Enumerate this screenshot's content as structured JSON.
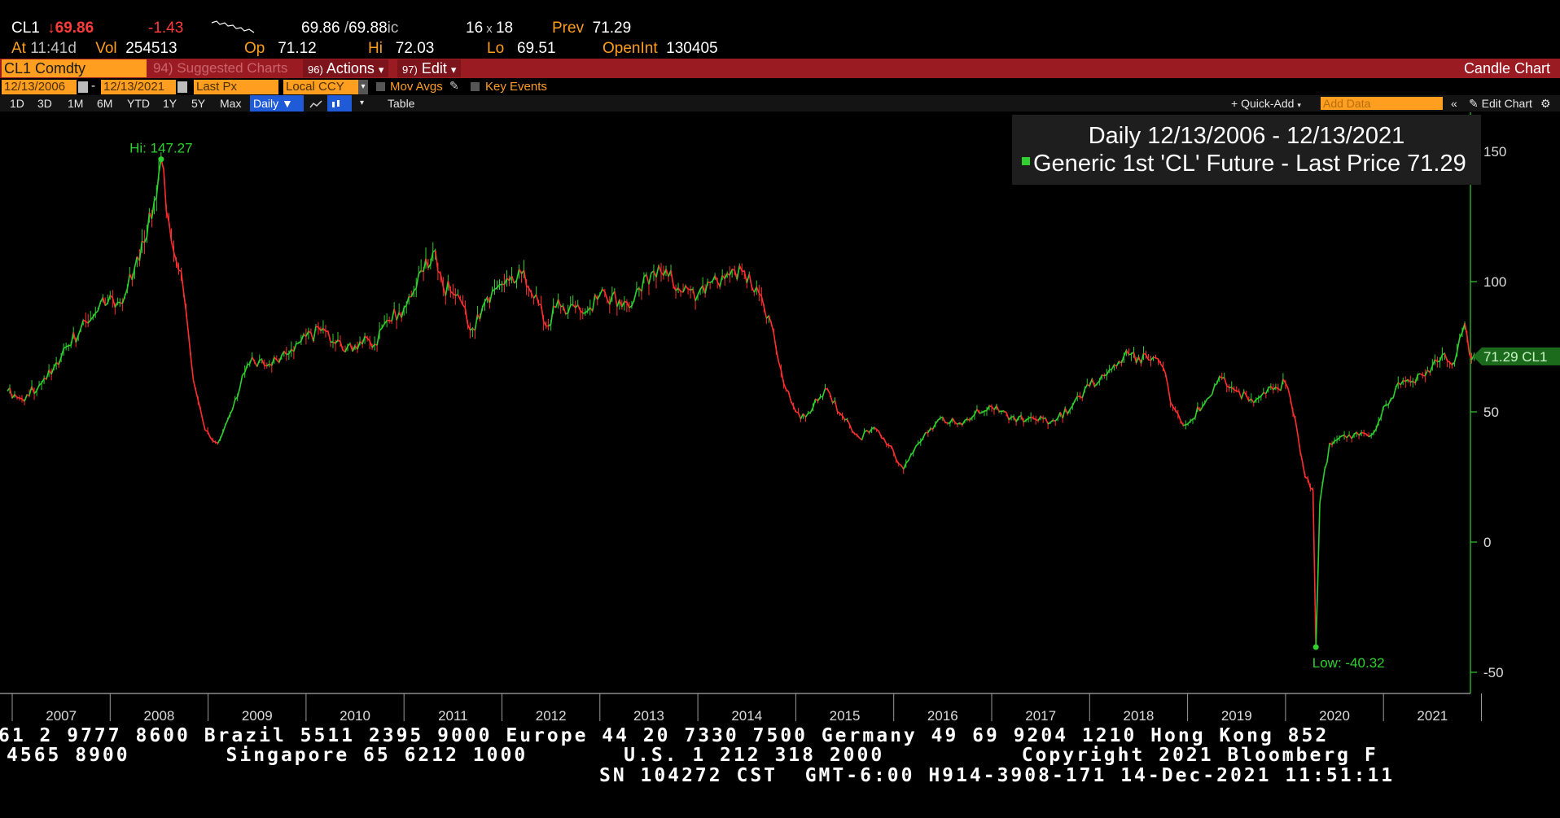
{
  "quote": {
    "ticker": "CL1",
    "last": "69.86",
    "change": "-1.43",
    "bid_ask_a": "69.86",
    "bid_ask_b": "69.88",
    "bid_ask_suffix": "ic",
    "size_a": "16",
    "size_b": "18",
    "prev_label": "Prev",
    "prev": "71.29",
    "at_label": "At",
    "time": "11:41d",
    "vol_label": "Vol",
    "vol": "254513",
    "op_label": "Op",
    "op": "71.12",
    "hi_label": "Hi",
    "hi": "72.03",
    "lo_label": "Lo",
    "lo": "69.51",
    "oi_label": "OpenInt",
    "oi": "130405"
  },
  "toolbar": {
    "security": "CL1 Comdty",
    "suggested": "94) Suggested Charts",
    "actions_num": "96)",
    "actions": "Actions",
    "edit_num": "97)",
    "edit": "Edit",
    "chart_type": "Candle Chart",
    "start_date": "12/13/2006",
    "end_date": "12/13/2021",
    "field": "Last Px",
    "currency": "Local CCY",
    "mov_avgs": "Mov Avgs",
    "key_events": "Key Events",
    "ranges": [
      "1D",
      "3D",
      "1M",
      "6M",
      "YTD",
      "1Y",
      "5Y",
      "Max"
    ],
    "period": "Daily",
    "table": "Table",
    "quick_add": "Quick-Add",
    "add_data_placeholder": "Add Data",
    "edit_chart": "Edit Chart"
  },
  "chart_data": {
    "type": "line",
    "legend_title": "Daily 12/13/2006 - 12/13/2021",
    "series_name": "Generic 1st 'CL' Future - Last Price",
    "last_price": "71.29",
    "last_tag": "71.29 CL1",
    "hi_label": "Hi: 147.27",
    "low_label": "Low: -40.32",
    "ylim": [
      -50,
      150
    ],
    "yticks": [
      "150",
      "100",
      "50",
      "0",
      "-50"
    ],
    "year_labels": [
      "2007",
      "2008",
      "2009",
      "2010",
      "2011",
      "2012",
      "2013",
      "2014",
      "2015",
      "2016",
      "2017",
      "2018",
      "2019",
      "2020",
      "2021"
    ],
    "x": [
      2006.95,
      2007.1,
      2007.3,
      2007.5,
      2007.7,
      2007.9,
      2008.1,
      2008.3,
      2008.45,
      2008.52,
      2008.6,
      2008.75,
      2008.85,
      2008.97,
      2009.1,
      2009.25,
      2009.4,
      2009.55,
      2009.7,
      2009.85,
      2010.0,
      2010.2,
      2010.4,
      2010.55,
      2010.7,
      2010.85,
      2011.0,
      2011.15,
      2011.32,
      2011.4,
      2011.55,
      2011.7,
      2011.85,
      2012.0,
      2012.2,
      2012.35,
      2012.45,
      2012.55,
      2012.7,
      2012.85,
      2013.0,
      2013.2,
      2013.35,
      2013.55,
      2013.7,
      2013.85,
      2014.0,
      2014.2,
      2014.45,
      2014.6,
      2014.75,
      2014.85,
      2015.0,
      2015.1,
      2015.3,
      2015.5,
      2015.65,
      2015.8,
      2015.95,
      2016.1,
      2016.3,
      2016.5,
      2016.7,
      2016.85,
      2017.0,
      2017.2,
      2017.45,
      2017.6,
      2017.8,
      2018.0,
      2018.2,
      2018.4,
      2018.6,
      2018.75,
      2018.85,
      2018.98,
      2019.2,
      2019.35,
      2019.5,
      2019.65,
      2019.8,
      2020.0,
      2020.1,
      2020.2,
      2020.28,
      2020.31,
      2020.35,
      2020.45,
      2020.6,
      2020.75,
      2020.9,
      2021.0,
      2021.2,
      2021.4,
      2021.6,
      2021.7,
      2021.83,
      2021.9,
      2021.95
    ],
    "values": [
      58,
      55,
      61,
      71,
      82,
      92,
      92,
      108,
      131,
      147,
      123,
      96,
      62,
      43,
      38,
      51,
      68,
      70,
      70,
      74,
      79,
      81,
      73,
      77,
      76,
      85,
      90,
      103,
      112,
      98,
      95,
      82,
      94,
      99,
      103,
      95,
      83,
      90,
      91,
      88,
      95,
      93,
      93,
      104,
      102,
      96,
      95,
      100,
      104,
      98,
      84,
      66,
      50,
      48,
      59,
      47,
      40,
      44,
      37,
      28,
      40,
      48,
      45,
      51,
      52,
      48,
      47,
      46,
      51,
      60,
      66,
      72,
      70,
      67,
      52,
      45,
      55,
      63,
      58,
      55,
      57,
      61,
      47,
      25,
      20,
      -40.32,
      15,
      38,
      41,
      41,
      42,
      52,
      62,
      64,
      72,
      68,
      84,
      70,
      71.29
    ]
  },
  "footer": {
    "line1": "61 2 9777 8600 Brazil 5511 2395 9000 Europe 44 20 7330 7500 Germany 49 69 9204 1210 Hong Kong 852",
    "line2": "4565 8900       Singapore 65 6212 1000       U.S. 1 212 318 2000          Copyright 2021 Bloomberg F",
    "line3": "SN 104272 CST  GMT-6:00 H914-3908-171 14-Dec-2021 11:51:11"
  },
  "colors": {
    "up": "#2fd02f",
    "down": "#ff2e2e",
    "accent_orange": "#ff9e1f",
    "command_bar": "#9b1b23",
    "axis_green": "#2fd02f"
  }
}
